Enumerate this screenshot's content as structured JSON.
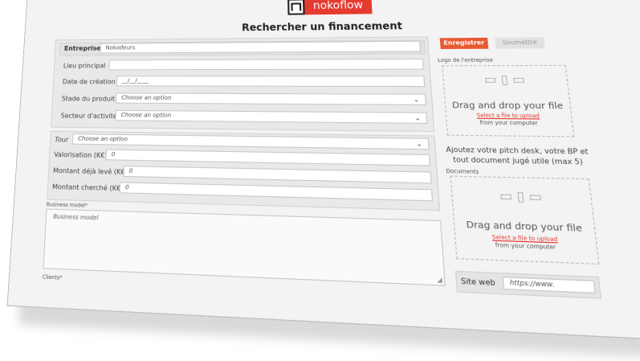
{
  "brand": {
    "name": "nokoflow"
  },
  "page": {
    "title": "Rechercher un financement"
  },
  "actions": {
    "save": "Enregistrer",
    "submit": "Soumettre"
  },
  "company": {
    "entreprise_label": "Entreprise",
    "entreprise_value": "Nokodeurs",
    "lieu_label": "Lieu principal",
    "date_label": "Date de création",
    "date_value": "__/__/____",
    "stade_label": "Stade du produit",
    "stade_value": "Choose an option",
    "secteur_label": "Secteur d'activité",
    "secteur_value": "Choose an option"
  },
  "funding": {
    "tour_label": "Tour",
    "tour_value": "Choose an option",
    "valo_label": "Valorisation (K€)",
    "valo_value": "0",
    "leve_label": "Montant déjà levé (K€)",
    "leve_value": "0",
    "cherche_label": "Montant cherché (K€)",
    "cherche_value": "0"
  },
  "business": {
    "label": "Business model*",
    "placeholder": "Business model"
  },
  "clients": {
    "label": "Clients*"
  },
  "logo_upload": {
    "label": "Logo de l'entreprise",
    "main": "Drag and drop your file",
    "link": "Select a file to upload",
    "sub": "from your computer"
  },
  "pitch": {
    "text": "Ajoutez votre pitch desk, votre BP et tout document jugé utile (max 5)"
  },
  "documents_upload": {
    "label": "Documents",
    "main": "Drag and drop your file",
    "link": "Select a file to upload",
    "sub": "from your computer"
  },
  "website": {
    "label": "Site web",
    "value": "https://www."
  },
  "icons": [
    "image-icon",
    "file-icon",
    "folder-icon",
    "chevron-down-icon"
  ]
}
